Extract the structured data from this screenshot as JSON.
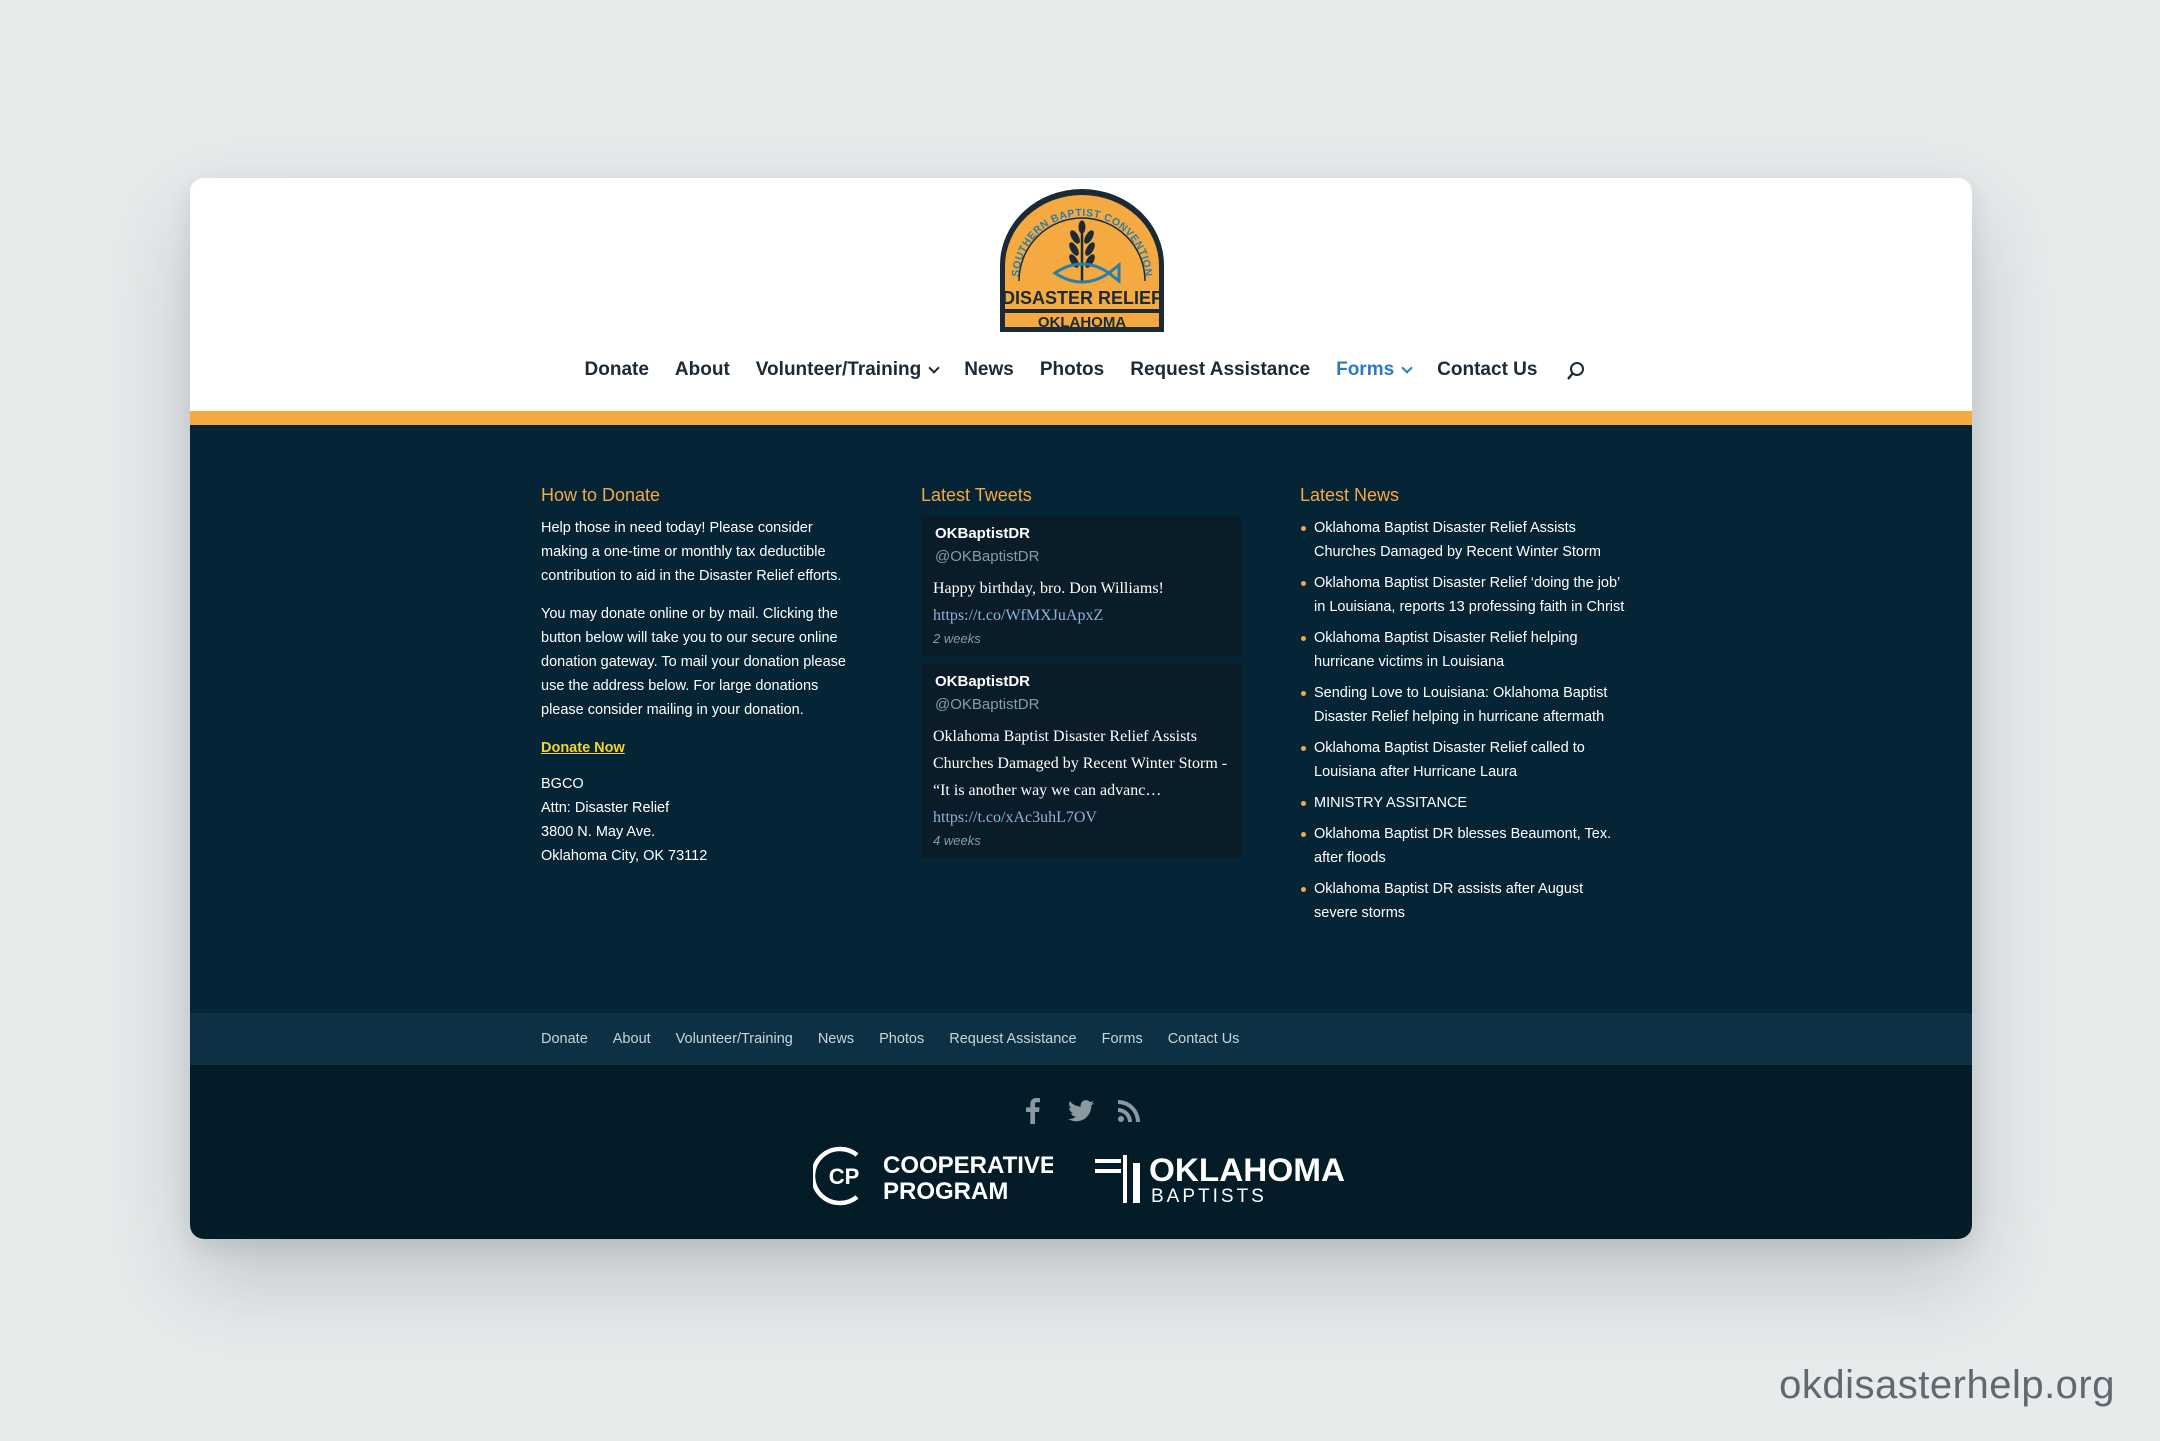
{
  "header": {
    "logo": {
      "ring_text": "SOUTHERN BAPTIST CONVENTION",
      "main_text": "DISASTER RELIEF",
      "sub_text": "OKLAHOMA",
      "colors": {
        "fill": "#f5a941",
        "outline": "#1c2a35",
        "accent": "#2a7fa8"
      }
    },
    "nav": [
      {
        "label": "Donate"
      },
      {
        "label": "About"
      },
      {
        "label": "Volunteer/Training"
      },
      {
        "label": "News"
      },
      {
        "label": "Photos"
      },
      {
        "label": "Request Assistance"
      },
      {
        "label": "Forms"
      },
      {
        "label": "Contact Us"
      }
    ],
    "search_icon": "search-icon"
  },
  "colors": {
    "accent_orange": "#f5a941",
    "active_link": "#2b7ac4",
    "widget_bg": "#052536",
    "donate_link": "#f5d328"
  },
  "donate": {
    "title": "How to Donate",
    "para1": "Help those in need today! Please consider making a one-time or monthly tax deductible contribution to aid in the Disaster Relief efforts.",
    "para2": "You may donate online or by mail. Clicking the button below will take you to our secure online donation gateway. To mail your donation please use the address below. For large donations please consider mailing in your donation.",
    "link": "Donate Now",
    "address": [
      "BGCO",
      "Attn: Disaster Relief",
      "3800 N. May Ave.",
      "Oklahoma City, OK 73112"
    ]
  },
  "tweets": {
    "title": "Latest Tweets",
    "items": [
      {
        "name": "OKBaptistDR",
        "handle": "@OKBaptistDR",
        "text": "Happy birthday, bro. Don Williams!",
        "link": "https://t.co/WfMXJuApxZ",
        "time": "2 weeks"
      },
      {
        "name": "OKBaptistDR",
        "handle": "@OKBaptistDR",
        "text": "Oklahoma Baptist Disaster Relief Assists Churches Damaged by Recent Winter Storm - “It is another way we can advanc…",
        "link": "https://t.co/xAc3uhL7OV",
        "time": "4 weeks"
      }
    ]
  },
  "news": {
    "title": "Latest News",
    "items": [
      "Oklahoma Baptist Disaster Relief Assists Churches Damaged by Recent Winter Storm",
      "Oklahoma Baptist Disaster Relief ‘doing the job’ in Louisiana, reports 13 professing faith in Christ",
      "Oklahoma Baptist Disaster Relief helping hurricane victims in Louisiana",
      "Sending Love to Louisiana: Oklahoma Baptist Disaster Relief helping in hurricane aftermath",
      "Oklahoma Baptist Disaster Relief called to Louisiana after Hurricane Laura",
      "MINISTRY ASSITANCE",
      "Oklahoma Baptist DR blesses Beaumont, Tex. after floods",
      "Oklahoma Baptist DR assists after August severe storms"
    ]
  },
  "footer_nav": [
    "Donate",
    "About",
    "Volunteer/Training",
    "News",
    "Photos",
    "Request Assistance",
    "Forms",
    "Contact Us"
  ],
  "social": [
    "facebook-icon",
    "twitter-icon",
    "rss-icon"
  ],
  "partners": {
    "cp_badge": "CP",
    "cp_line1": "COOPERATIVE",
    "cp_line2": "PROGRAM",
    "ok_line1": "OKLAHOMA",
    "ok_line2": "BAPTISTS"
  },
  "watermark": "okdisasterhelp.org"
}
